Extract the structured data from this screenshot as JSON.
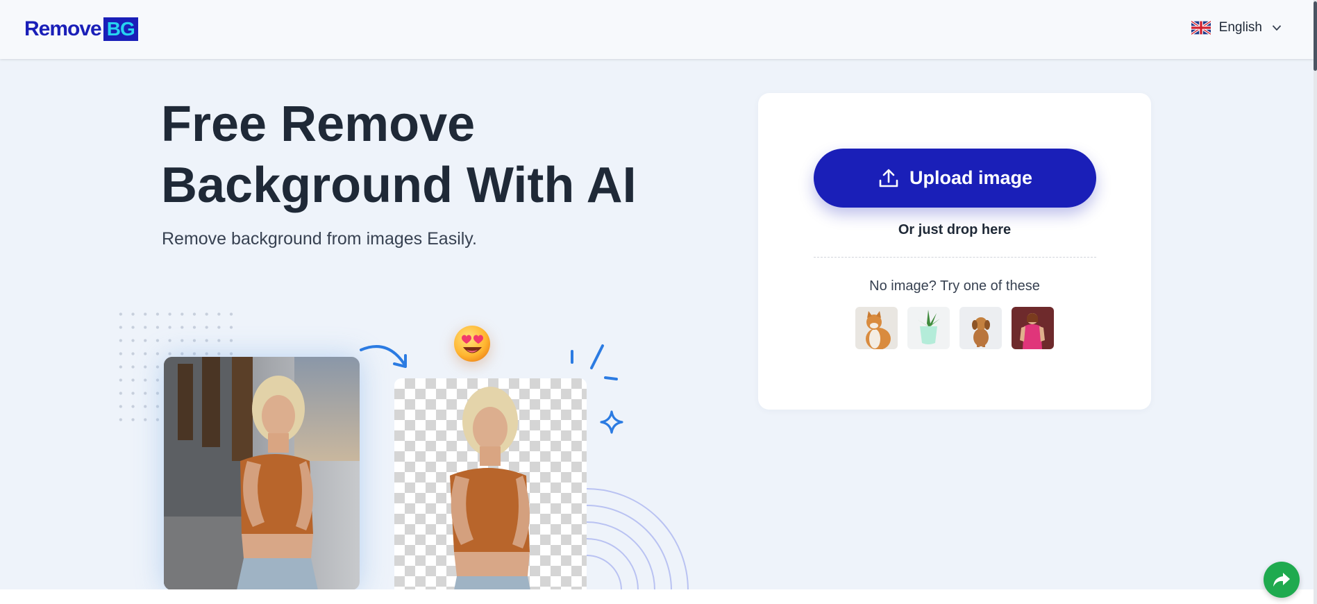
{
  "header": {
    "logo_text": "Remove",
    "logo_badge": "BG",
    "language": {
      "selected": "English",
      "flag_icon": "uk-flag-icon",
      "dropdown_icon": "chevron-down-icon"
    }
  },
  "hero": {
    "title_line1": "Free Remove",
    "title_line2": "Background With AI",
    "subtitle": "Remove background from images Easily."
  },
  "upload": {
    "button_label": "Upload image",
    "button_icon": "upload-icon",
    "drop_text": "Or just drop here",
    "try_text": "No image? Try one of these",
    "samples": [
      {
        "name": "cat",
        "icon": "cat-sample-thumbnail"
      },
      {
        "name": "plant",
        "icon": "plant-sample-thumbnail"
      },
      {
        "name": "puppy",
        "icon": "puppy-sample-thumbnail"
      },
      {
        "name": "woman",
        "icon": "woman-sample-thumbnail"
      }
    ]
  },
  "colors": {
    "brand": "#1a1fb8",
    "brand_accent": "#27d3f0",
    "background": "#eef3fa",
    "share": "#1faa4f"
  },
  "share": {
    "icon": "share-arrow-icon"
  }
}
